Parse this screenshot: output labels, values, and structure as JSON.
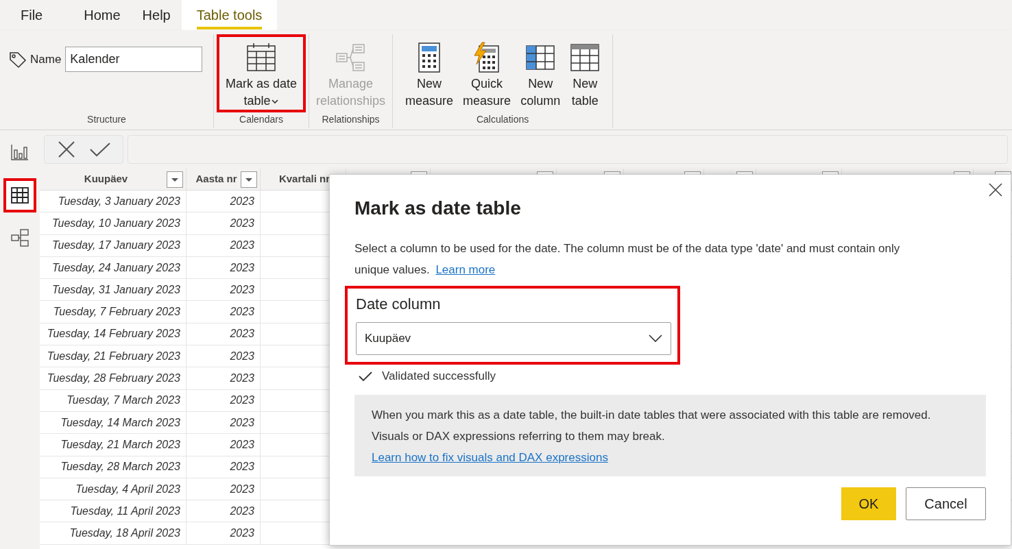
{
  "ribbon": {
    "tabs": [
      {
        "label": "File",
        "selected": false
      },
      {
        "label": "Home",
        "selected": false
      },
      {
        "label": "Help",
        "selected": false
      },
      {
        "label": "Table tools",
        "selected": true
      }
    ],
    "name_field": {
      "label": "Name",
      "value": "Kalender"
    },
    "groups": [
      {
        "label": "Structure",
        "kind": "name"
      },
      {
        "label": "Calendars",
        "kind": "buttons",
        "buttons": [
          {
            "label": "Mark as date table",
            "kind": "calendar",
            "disabled": false,
            "dropdown": true,
            "highlighted": true
          }
        ]
      },
      {
        "label": "Relationships",
        "kind": "buttons",
        "buttons": [
          {
            "label": "Manage relationships",
            "kind": "relationships",
            "disabled": true,
            "dropdown": false,
            "highlighted": false
          }
        ]
      },
      {
        "label": "Calculations",
        "kind": "buttons",
        "buttons": [
          {
            "label": "New measure",
            "kind": "measure",
            "disabled": false,
            "dropdown": false,
            "highlighted": false
          },
          {
            "label": "Quick measure",
            "kind": "quick",
            "disabled": false,
            "dropdown": false,
            "highlighted": false
          },
          {
            "label": "New column",
            "kind": "column",
            "disabled": false,
            "dropdown": false,
            "highlighted": false
          },
          {
            "label": "New table",
            "kind": "table",
            "disabled": false,
            "dropdown": false,
            "highlighted": false
          }
        ]
      }
    ]
  },
  "sidebar": {
    "items": [
      {
        "kind": "report",
        "selected": false
      },
      {
        "kind": "data",
        "selected": true
      },
      {
        "kind": "model",
        "selected": false
      }
    ]
  },
  "table": {
    "columns": [
      "Kuupäev",
      "Aasta nr",
      "Kvartali nr"
    ],
    "rows": [
      [
        "Tuesday, 3 January 2023",
        "2023"
      ],
      [
        "Tuesday, 10 January 2023",
        "2023"
      ],
      [
        "Tuesday, 17 January 2023",
        "2023"
      ],
      [
        "Tuesday, 24 January 2023",
        "2023"
      ],
      [
        "Tuesday, 31 January 2023",
        "2023"
      ],
      [
        "Tuesday, 7 February 2023",
        "2023"
      ],
      [
        "Tuesday, 14 February 2023",
        "2023"
      ],
      [
        "Tuesday, 21 February 2023",
        "2023"
      ],
      [
        "Tuesday, 28 February 2023",
        "2023"
      ],
      [
        "Tuesday, 7 March 2023",
        "2023"
      ],
      [
        "Tuesday, 14 March 2023",
        "2023"
      ],
      [
        "Tuesday, 21 March 2023",
        "2023"
      ],
      [
        "Tuesday, 28 March 2023",
        "2023"
      ],
      [
        "Tuesday, 4 April 2023",
        "2023"
      ],
      [
        "Tuesday, 11 April 2023",
        "2023"
      ],
      [
        "Tuesday, 18 April 2023",
        "2023"
      ]
    ]
  },
  "dialog": {
    "title": "Mark as date table",
    "description": "Select a column to be used for the date. The column must be of the data type 'date' and must contain only unique values.",
    "learn_more": "Learn more",
    "date_column": {
      "label": "Date column",
      "value": "Kuupäev",
      "highlighted": true
    },
    "validation": "Validated successfully",
    "warning": {
      "text": "When you mark this as a date table, the built-in date tables that were associated with this table are removed. Visuals or DAX expressions referring to them may break.",
      "link": "Learn how to fix visuals and DAX expressions"
    },
    "buttons": [
      {
        "label": "OK",
        "kind": "primary"
      },
      {
        "label": "Cancel",
        "kind": "secondary"
      }
    ]
  }
}
